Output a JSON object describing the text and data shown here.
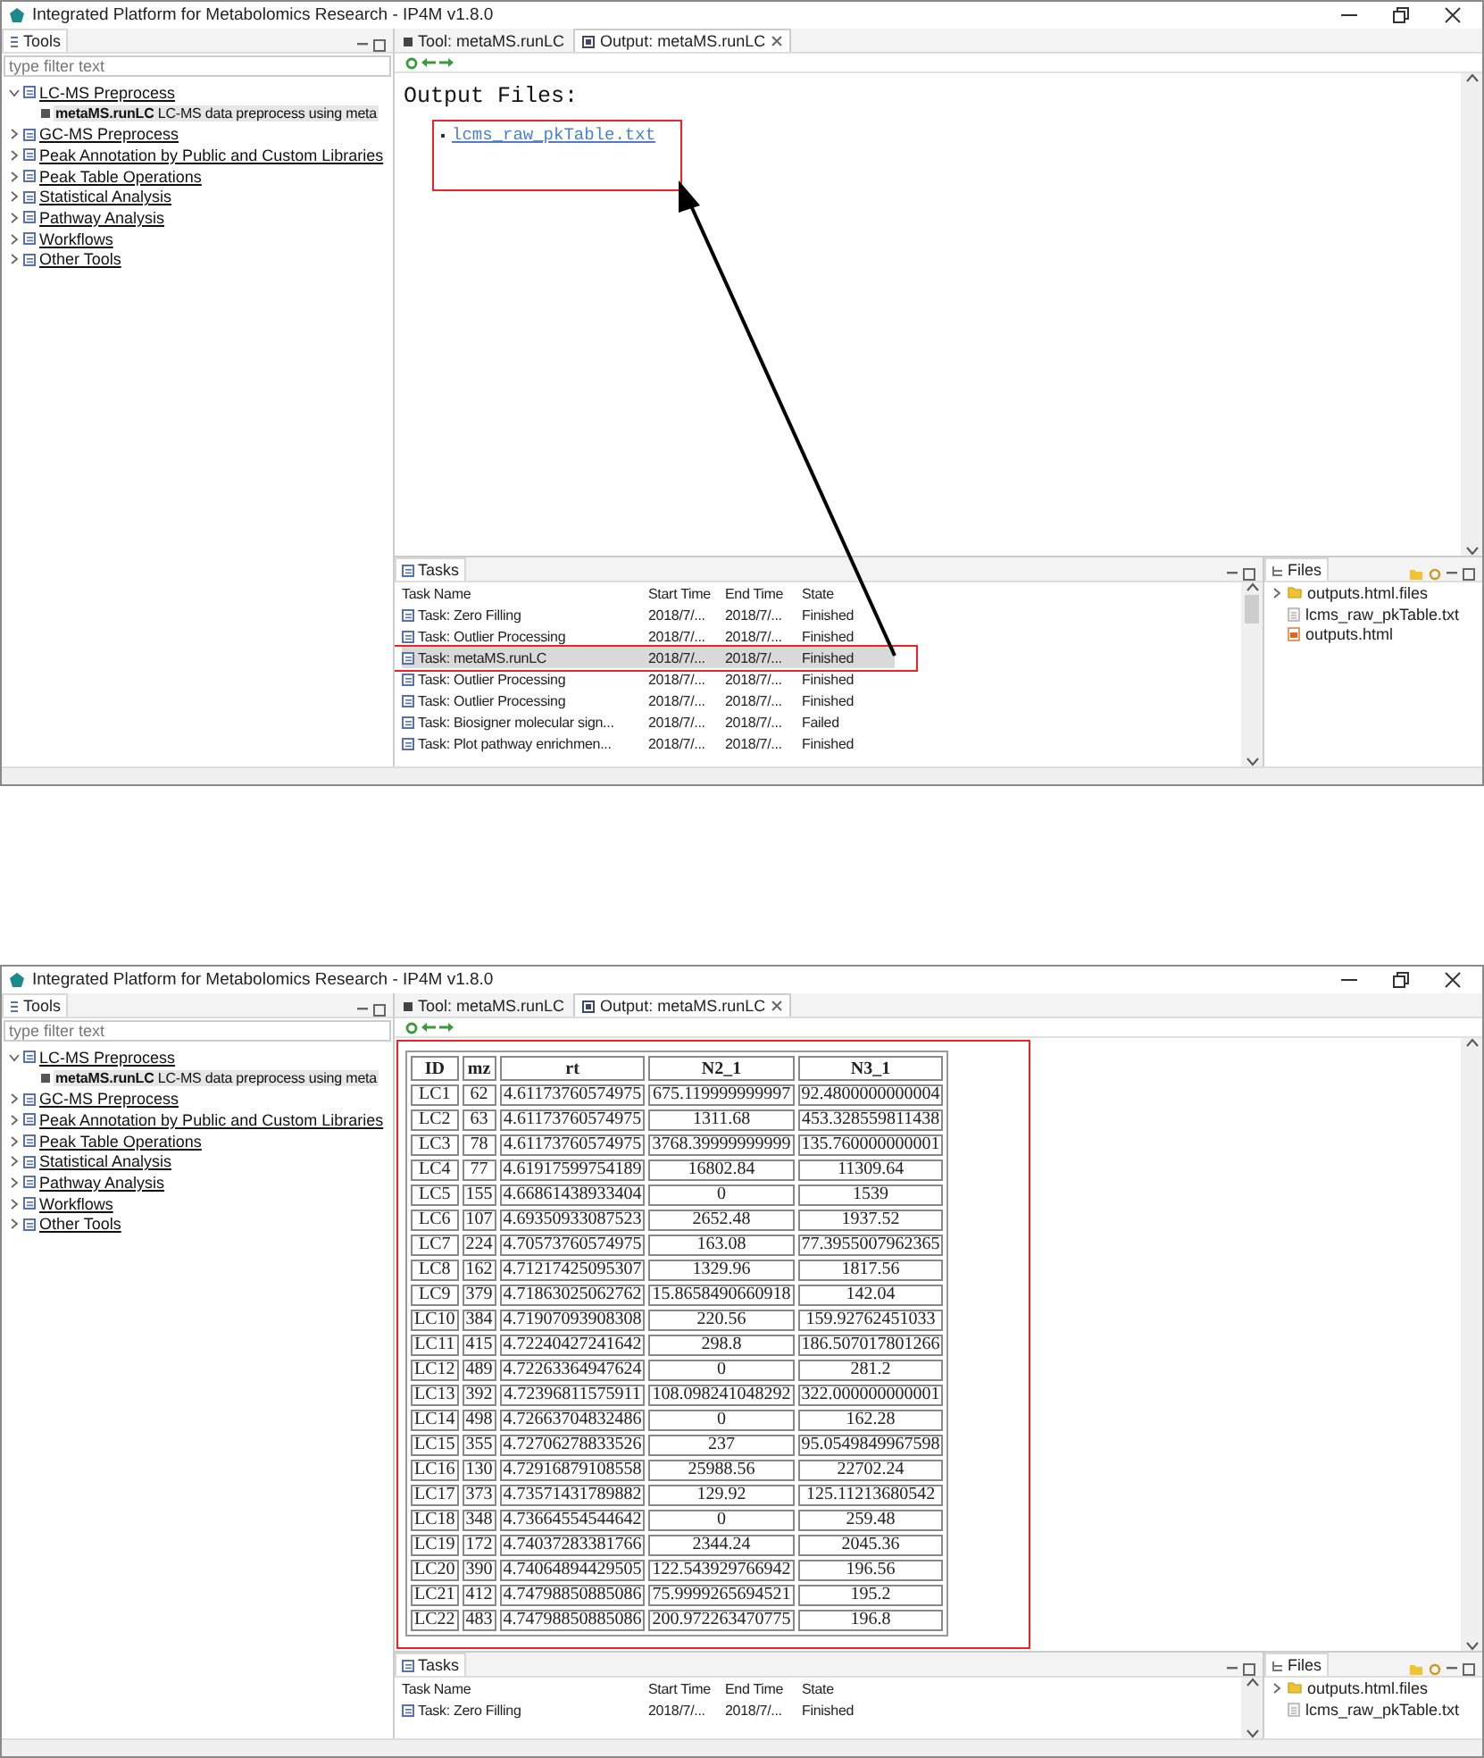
{
  "screens": [
    {
      "window": {
        "title": "Integrated Platform for Metabolomics Research - IP4M v1.8.0"
      },
      "tools": {
        "title": "Tools",
        "filter": {
          "placeholder": "type filter text"
        },
        "items": [
          {
            "label": "LC-MS Preprocess",
            "expanded": true,
            "children": [
              {
                "name": "metaMS.runLC",
                "description": "LC-MS data preprocess using meta",
                "selected": true
              }
            ]
          },
          {
            "label": "GC-MS Preprocess",
            "expanded": false
          },
          {
            "label": "Peak Annotation by Public and Custom Libraries",
            "expanded": false
          },
          {
            "label": "Peak Table Operations",
            "expanded": false
          },
          {
            "label": "Statistical Analysis",
            "expanded": false
          },
          {
            "label": "Pathway Analysis",
            "expanded": false
          },
          {
            "label": "Workflows",
            "expanded": false
          },
          {
            "label": "Other Tools",
            "expanded": false
          }
        ]
      },
      "editor": {
        "tabs": [
          {
            "label": "Tool: metaMS.runLC",
            "selected": false,
            "closable": false
          },
          {
            "label": "Output: metaMS.runLC",
            "selected": true,
            "closable": true
          }
        ],
        "output": {
          "kind": "files",
          "heading": "Output Files:",
          "highlighted": true,
          "links": [
            "lcms_raw_pkTable.txt"
          ]
        }
      },
      "tasks": {
        "title": "Tasks",
        "columns": [
          "Task Name",
          "Start Time",
          "End Time",
          "State"
        ],
        "rows": [
          {
            "name": "Task: Zero Filling",
            "start": "2018/7/...",
            "end": "2018/7/...",
            "state": "Finished",
            "selected": false,
            "highlighted": false
          },
          {
            "name": "Task: Outlier Processing",
            "start": "2018/7/...",
            "end": "2018/7/...",
            "state": "Finished",
            "selected": false,
            "highlighted": false
          },
          {
            "name": "Task: metaMS.runLC",
            "start": "2018/7/...",
            "end": "2018/7/...",
            "state": "Finished",
            "selected": true,
            "highlighted": true
          },
          {
            "name": "Task: Outlier Processing",
            "start": "2018/7/...",
            "end": "2018/7/...",
            "state": "Finished",
            "selected": false,
            "highlighted": false
          },
          {
            "name": "Task: Outlier Processing",
            "start": "2018/7/...",
            "end": "2018/7/...",
            "state": "Finished",
            "selected": false,
            "highlighted": false
          },
          {
            "name": "Task: Biosigner molecular sign...",
            "start": "2018/7/...",
            "end": "2018/7/...",
            "state": "Failed",
            "selected": false,
            "highlighted": false
          },
          {
            "name": "Task: Plot pathway enrichmen...",
            "start": "2018/7/...",
            "end": "2018/7/...",
            "state": "Finished",
            "selected": false,
            "highlighted": false
          }
        ]
      },
      "files": {
        "title": "Files",
        "items": [
          {
            "name": "outputs.html.files",
            "kind": "folder"
          },
          {
            "name": "lcms_raw_pkTable.txt",
            "kind": "text"
          },
          {
            "name": "outputs.html",
            "kind": "html"
          }
        ]
      },
      "arrow": true
    },
    {
      "window": {
        "title": "Integrated Platform for Metabolomics Research - IP4M v1.8.0"
      },
      "tools": {
        "title": "Tools",
        "filter": {
          "placeholder": "type filter text"
        },
        "items": [
          {
            "label": "LC-MS Preprocess",
            "expanded": true,
            "children": [
              {
                "name": "metaMS.runLC",
                "description": "LC-MS data preprocess using meta",
                "selected": true
              }
            ]
          },
          {
            "label": "GC-MS Preprocess",
            "expanded": false
          },
          {
            "label": "Peak Annotation by Public and Custom Libraries",
            "expanded": false
          },
          {
            "label": "Peak Table Operations",
            "expanded": false
          },
          {
            "label": "Statistical Analysis",
            "expanded": false
          },
          {
            "label": "Pathway Analysis",
            "expanded": false
          },
          {
            "label": "Workflows",
            "expanded": false
          },
          {
            "label": "Other Tools",
            "expanded": false
          }
        ]
      },
      "editor": {
        "tabs": [
          {
            "label": "Tool: metaMS.runLC",
            "selected": false,
            "closable": false
          },
          {
            "label": "Output: metaMS.runLC",
            "selected": true,
            "closable": true
          }
        ],
        "output": {
          "kind": "table",
          "highlighted": true,
          "columns": [
            "ID",
            "mz",
            "rt",
            "N2_1",
            "N3_1"
          ],
          "rows": [
            [
              "LC1",
              "62",
              "4.61173760574975",
              "675.119999999997",
              "92.4800000000004"
            ],
            [
              "LC2",
              "63",
              "4.61173760574975",
              "1311.68",
              "453.328559811438"
            ],
            [
              "LC3",
              "78",
              "4.61173760574975",
              "3768.39999999999",
              "135.760000000001"
            ],
            [
              "LC4",
              "77",
              "4.61917599754189",
              "16802.84",
              "11309.64"
            ],
            [
              "LC5",
              "155",
              "4.66861438933404",
              "0",
              "1539"
            ],
            [
              "LC6",
              "107",
              "4.69350933087523",
              "2652.48",
              "1937.52"
            ],
            [
              "LC7",
              "224",
              "4.70573760574975",
              "163.08",
              "77.3955007962365"
            ],
            [
              "LC8",
              "162",
              "4.71217425095307",
              "1329.96",
              "1817.56"
            ],
            [
              "LC9",
              "379",
              "4.71863025062762",
              "15.8658490660918",
              "142.04"
            ],
            [
              "LC10",
              "384",
              "4.71907093908308",
              "220.56",
              "159.92762451033"
            ],
            [
              "LC11",
              "415",
              "4.72240427241642",
              "298.8",
              "186.507017801266"
            ],
            [
              "LC12",
              "489",
              "4.72263364947624",
              "0",
              "281.2"
            ],
            [
              "LC13",
              "392",
              "4.72396811575911",
              "108.098241048292",
              "322.000000000001"
            ],
            [
              "LC14",
              "498",
              "4.72663704832486",
              "0",
              "162.28"
            ],
            [
              "LC15",
              "355",
              "4.72706278833526",
              "237",
              "95.0549849967598"
            ],
            [
              "LC16",
              "130",
              "4.72916879108558",
              "25988.56",
              "22702.24"
            ],
            [
              "LC17",
              "373",
              "4.73571431789882",
              "129.92",
              "125.11213680542"
            ],
            [
              "LC18",
              "348",
              "4.73664554544642",
              "0",
              "259.48"
            ],
            [
              "LC19",
              "172",
              "4.74037283381766",
              "2344.24",
              "2045.36"
            ],
            [
              "LC20",
              "390",
              "4.74064894429505",
              "122.543929766942",
              "196.56"
            ],
            [
              "LC21",
              "412",
              "4.74798850885086",
              "75.9999265694521",
              "195.2"
            ],
            [
              "LC22",
              "483",
              "4.74798850885086",
              "200.972263470775",
              "196.8"
            ]
          ]
        }
      },
      "tasks": {
        "title": "Tasks",
        "columns": [
          "Task Name",
          "Start Time",
          "End Time",
          "State"
        ],
        "rows": [
          {
            "name": "Task: Zero Filling",
            "start": "2018/7/...",
            "end": "2018/7/...",
            "state": "Finished",
            "selected": false,
            "highlighted": false
          }
        ]
      },
      "files": {
        "title": "Files",
        "items": [
          {
            "name": "outputs.html.files",
            "kind": "folder"
          },
          {
            "name": "lcms_raw_pkTable.txt",
            "kind": "text"
          }
        ]
      }
    }
  ]
}
